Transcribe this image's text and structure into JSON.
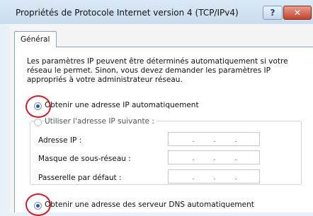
{
  "window": {
    "title": "Propriétés de Protocole Internet version 4 (TCP/IPv4)",
    "help_label": "?",
    "close_label": "✕"
  },
  "tabs": [
    {
      "label": "Général",
      "selected": true
    }
  ],
  "description": "Les paramètres IP peuvent être déterminés automatiquement si votre\nréseau le permet. Sinon, vous devez demander les paramètres IP\nappropriés à votre administrateur réseau.",
  "ip_mode": {
    "auto_label": "Obtenir une adresse IP automatiquement",
    "manual_label": "Utiliser l'adresse IP suivante :",
    "selected": "auto"
  },
  "fields": [
    {
      "label": "Adresse IP :",
      "value": ""
    },
    {
      "label": "Masque de sous-réseau :",
      "value": ""
    },
    {
      "label": "Passerelle par défaut :",
      "value": ""
    }
  ],
  "ip_separators": [
    ".",
    ".",
    "."
  ],
  "dns_mode": {
    "auto_label": "Obtenir une adresse des serveur DNS automatiquement",
    "selected": "auto"
  },
  "colors": {
    "annotation": "#cc1d2a",
    "radio_selected": "#1f5ca8",
    "close_button": "#c0432a"
  }
}
